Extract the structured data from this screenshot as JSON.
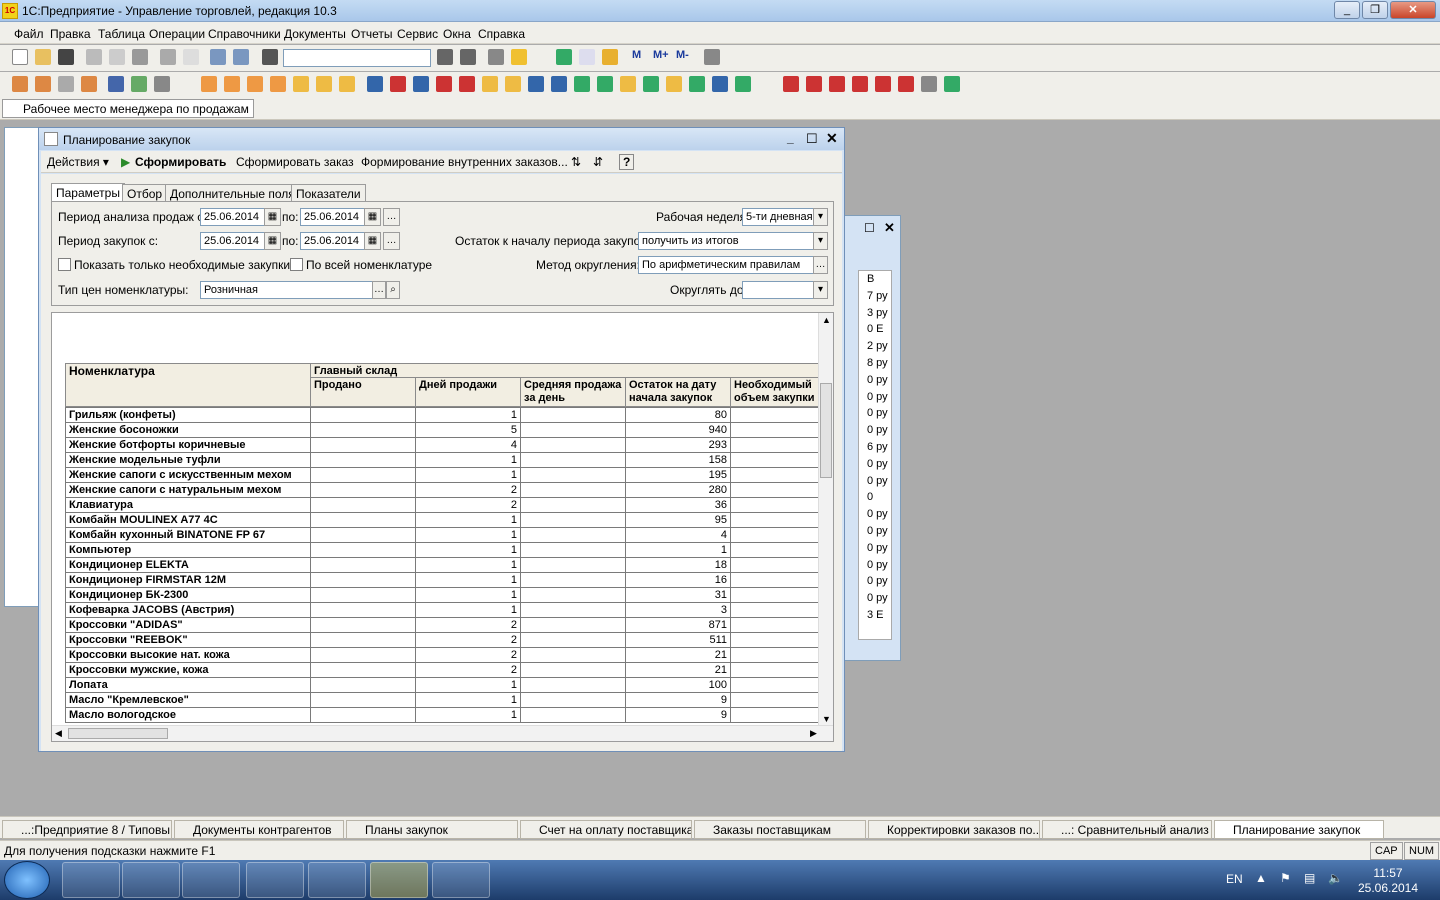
{
  "app": {
    "title": "1С:Предприятие - Управление торговлей, редакция 10.3",
    "logo": "1С"
  },
  "menu": [
    "Файл",
    "Правка",
    "Таблица",
    "Операции",
    "Справочники",
    "Документы",
    "Отчеты",
    "Сервис",
    "Окна",
    "Справка"
  ],
  "panel": {
    "tab": "Рабочее место менеджера по продажам"
  },
  "window": {
    "title": "Планирование закупок",
    "commands": {
      "actions": "Действия ▾",
      "generate": "Сформировать",
      "generate_order": "Сформировать заказ",
      "internal_orders": "Формирование внутренних заказов...",
      "help": "?"
    },
    "tabs": [
      "Параметры",
      "Отбор",
      "Дополнительные поля",
      "Показатели"
    ],
    "params": {
      "sales_period_label": "Период анализа продаж с:",
      "sales_from": "25.06.2014",
      "to_label": "по:",
      "sales_to": "25.06.2014",
      "purchase_period_label": "Период закупок с:",
      "purchase_from": "25.06.2014",
      "purchase_to": "25.06.2014",
      "work_week_label": "Рабочая неделя:",
      "work_week": "5-ти дневная",
      "balance_label": "Остаток к началу периода закупок:",
      "balance": "получить из итогов",
      "rounding_label": "Метод округления:",
      "rounding": "По арифметическим правилам",
      "only_needed": "Показать только необходимые закупки",
      "all_items": "По всей номенклатуре",
      "price_type_label": "Тип цен номенклатуры:",
      "price_type": "Розничная",
      "round_to_label": "Округлять до:",
      "round_to": ""
    },
    "report": {
      "headers": {
        "item": "Номенклатура",
        "warehouse": "Главный склад",
        "sold": "Продано",
        "days": "Дней продажи",
        "avg": "Средняя продажа за день",
        "stock": "Остаток на дату начала закупок",
        "needed": "Необходимый объем закупки"
      },
      "rows": [
        {
          "name": "Грильяж (конфеты)",
          "days": "1",
          "stock": "80"
        },
        {
          "name": "Женские босоножки",
          "days": "5",
          "stock": "940"
        },
        {
          "name": "Женские ботфорты коричневые",
          "days": "4",
          "stock": "293"
        },
        {
          "name": "Женские модельные туфли",
          "days": "1",
          "stock": "158"
        },
        {
          "name": "Женские сапоги с искусственным мехом",
          "days": "1",
          "stock": "195"
        },
        {
          "name": "Женские сапоги с натуральным мехом",
          "days": "2",
          "stock": "280"
        },
        {
          "name": "Клавиатура",
          "days": "2",
          "stock": "36"
        },
        {
          "name": "Комбайн MOULINEX  A77 4C",
          "days": "1",
          "stock": "95"
        },
        {
          "name": "Комбайн кухонный BINATONE FP 67",
          "days": "1",
          "stock": "4"
        },
        {
          "name": "Компьютер",
          "days": "1",
          "stock": "1"
        },
        {
          "name": "Кондиционер ELEKTA",
          "days": "1",
          "stock": "18"
        },
        {
          "name": "Кондиционер FIRMSTAR 12M",
          "days": "1",
          "stock": "16"
        },
        {
          "name": "Кондиционер БК-2300",
          "days": "1",
          "stock": "31"
        },
        {
          "name": "Кофеварка JACOBS (Австрия)",
          "days": "1",
          "stock": "3"
        },
        {
          "name": "Кроссовки \"ADIDAS\"",
          "days": "2",
          "stock": "871"
        },
        {
          "name": "Кроссовки \"REEBOK\"",
          "days": "2",
          "stock": "511"
        },
        {
          "name": "Кроссовки высокие нат. кожа",
          "days": "2",
          "stock": "21"
        },
        {
          "name": "Кроссовки мужские, кожа",
          "days": "2",
          "stock": "21"
        },
        {
          "name": "Лопата",
          "days": "1",
          "stock": "100"
        },
        {
          "name": "Масло \"Кремлевское\"",
          "days": "1",
          "stock": "9"
        },
        {
          "name": "Масло вологодское",
          "days": "1",
          "stock": "9"
        }
      ]
    }
  },
  "open_windows": [
    "...:Предприятие 8 / Типовы...",
    "Документы контрагентов",
    "Планы закупок",
    "Счет на оплату поставщика",
    "Заказы поставщикам",
    "Корректировки заказов по...",
    "...: Сравнительный анализ ...",
    "Планирование закупок"
  ],
  "status": {
    "hint": "Для получения подсказки нажмите F1",
    "cap": "CAP",
    "num": "NUM"
  },
  "tray": {
    "lang": "EN",
    "time": "11:57",
    "date": "25.06.2014"
  },
  "bg_col": {
    "header": "В",
    "cells": [
      "7 ру",
      "3 ру",
      "0 E",
      "2 ру",
      "8 ру",
      "0 ру",
      "0 ру",
      "0 ру",
      "0 ру",
      "6 ру",
      "0 ру",
      "0 ру",
      "0",
      "0 ру",
      "0 ру",
      "0 ру",
      "0 ру",
      "0 ру",
      "0 ру",
      "3 E"
    ]
  },
  "colors": {
    "accent": "#c4dbf3",
    "taskbar": "#1d3c6a"
  }
}
